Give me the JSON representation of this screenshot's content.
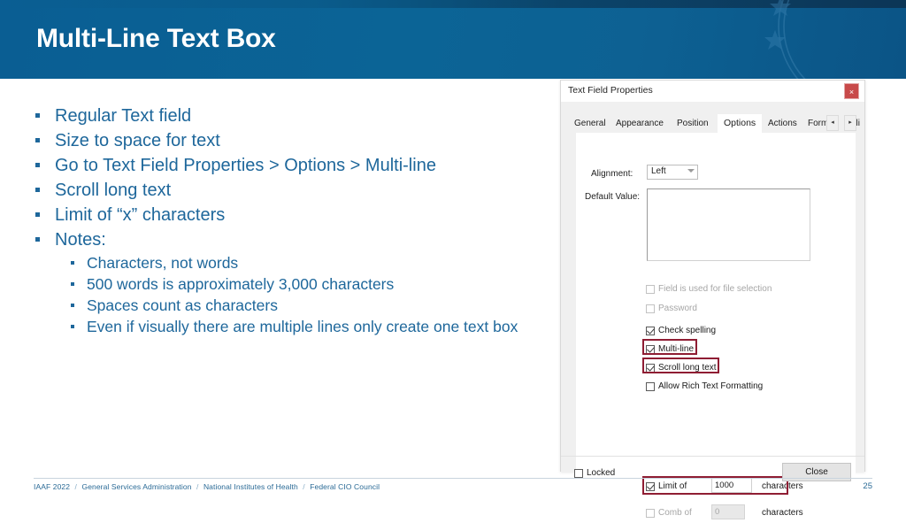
{
  "slide": {
    "title": "Multi-Line Text Box",
    "accent_color": "#0b6496",
    "body_text_color": "#1e679b",
    "highlight_color": "#8f1d33"
  },
  "bullets": [
    {
      "level": 1,
      "text": "Regular Text field"
    },
    {
      "level": 1,
      "text": "Size to space for text"
    },
    {
      "level": 1,
      "text": "Go to Text Field Properties > Options > Multi-line"
    },
    {
      "level": 1,
      "text": "Scroll long text"
    },
    {
      "level": 1,
      "text": "Limit of “x” characters"
    },
    {
      "level": 1,
      "text": "Notes:"
    },
    {
      "level": 2,
      "text": "Characters, not words"
    },
    {
      "level": 2,
      "text": "500 words is approximately 3,000 characters"
    },
    {
      "level": 2,
      "text": "Spaces count as characters"
    },
    {
      "level": 2,
      "text": "Even if visually there are multiple lines only create one text box"
    }
  ],
  "footer": {
    "items": [
      "IAAF 2022",
      "General Services Administration",
      "National Institutes of Health",
      "Federal CIO Council"
    ],
    "separator": "/",
    "page_number": "25"
  },
  "dialog": {
    "title": "Text Field Properties",
    "close_icon": "×",
    "tabs": [
      {
        "label": "General",
        "active": false
      },
      {
        "label": "Appearance",
        "active": false
      },
      {
        "label": "Position",
        "active": false
      },
      {
        "label": "Options",
        "active": true
      },
      {
        "label": "Actions",
        "active": false
      },
      {
        "label": "Format",
        "active": false
      },
      {
        "label": "Vali",
        "active": false
      }
    ],
    "tab_scroll_prev": "◂",
    "tab_scroll_next": "▸",
    "alignment": {
      "label": "Alignment:",
      "value": "Left"
    },
    "default_value": {
      "label": "Default Value:",
      "value": ""
    },
    "checkboxes": [
      {
        "label": "Field is used for file selection",
        "checked": false,
        "disabled": true,
        "highlighted": false
      },
      {
        "label": "Password",
        "checked": false,
        "disabled": true,
        "highlighted": false
      },
      {
        "label": "Check spelling",
        "checked": true,
        "disabled": false,
        "highlighted": false
      },
      {
        "label": "Multi-line",
        "checked": true,
        "disabled": false,
        "highlighted": true
      },
      {
        "label": "Scroll long text",
        "checked": true,
        "disabled": false,
        "highlighted": true
      },
      {
        "label": "Allow Rich Text Formatting",
        "checked": false,
        "disabled": false,
        "highlighted": false
      }
    ],
    "limit": {
      "label": "Limit of",
      "checked": true,
      "disabled": false,
      "value": "1000",
      "unit": "characters",
      "highlighted": true
    },
    "comb": {
      "label": "Comb of",
      "checked": false,
      "disabled": true,
      "value": "0",
      "unit": "characters",
      "highlighted": false
    },
    "locked": {
      "label": "Locked",
      "checked": false
    },
    "close_button": "Close"
  }
}
